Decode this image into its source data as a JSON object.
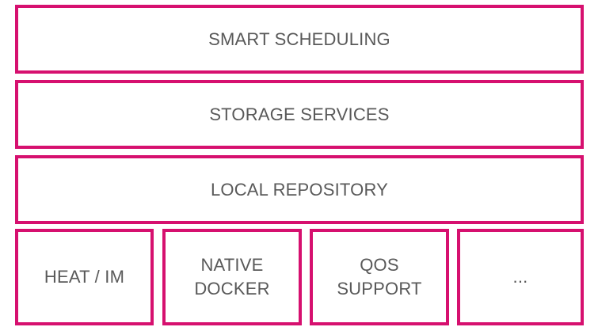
{
  "diagram": {
    "layers": [
      {
        "label": "SMART SCHEDULING"
      },
      {
        "label": "STORAGE SERVICES"
      },
      {
        "label": "LOCAL REPOSITORY"
      }
    ],
    "components": [
      {
        "lines": [
          "HEAT / IM"
        ]
      },
      {
        "lines": [
          "NATIVE",
          "DOCKER"
        ]
      },
      {
        "lines": [
          "QOS",
          "SUPPORT"
        ]
      },
      {
        "lines": [
          "..."
        ]
      }
    ],
    "colors": {
      "border": "#d6106f",
      "text": "#595959"
    }
  }
}
